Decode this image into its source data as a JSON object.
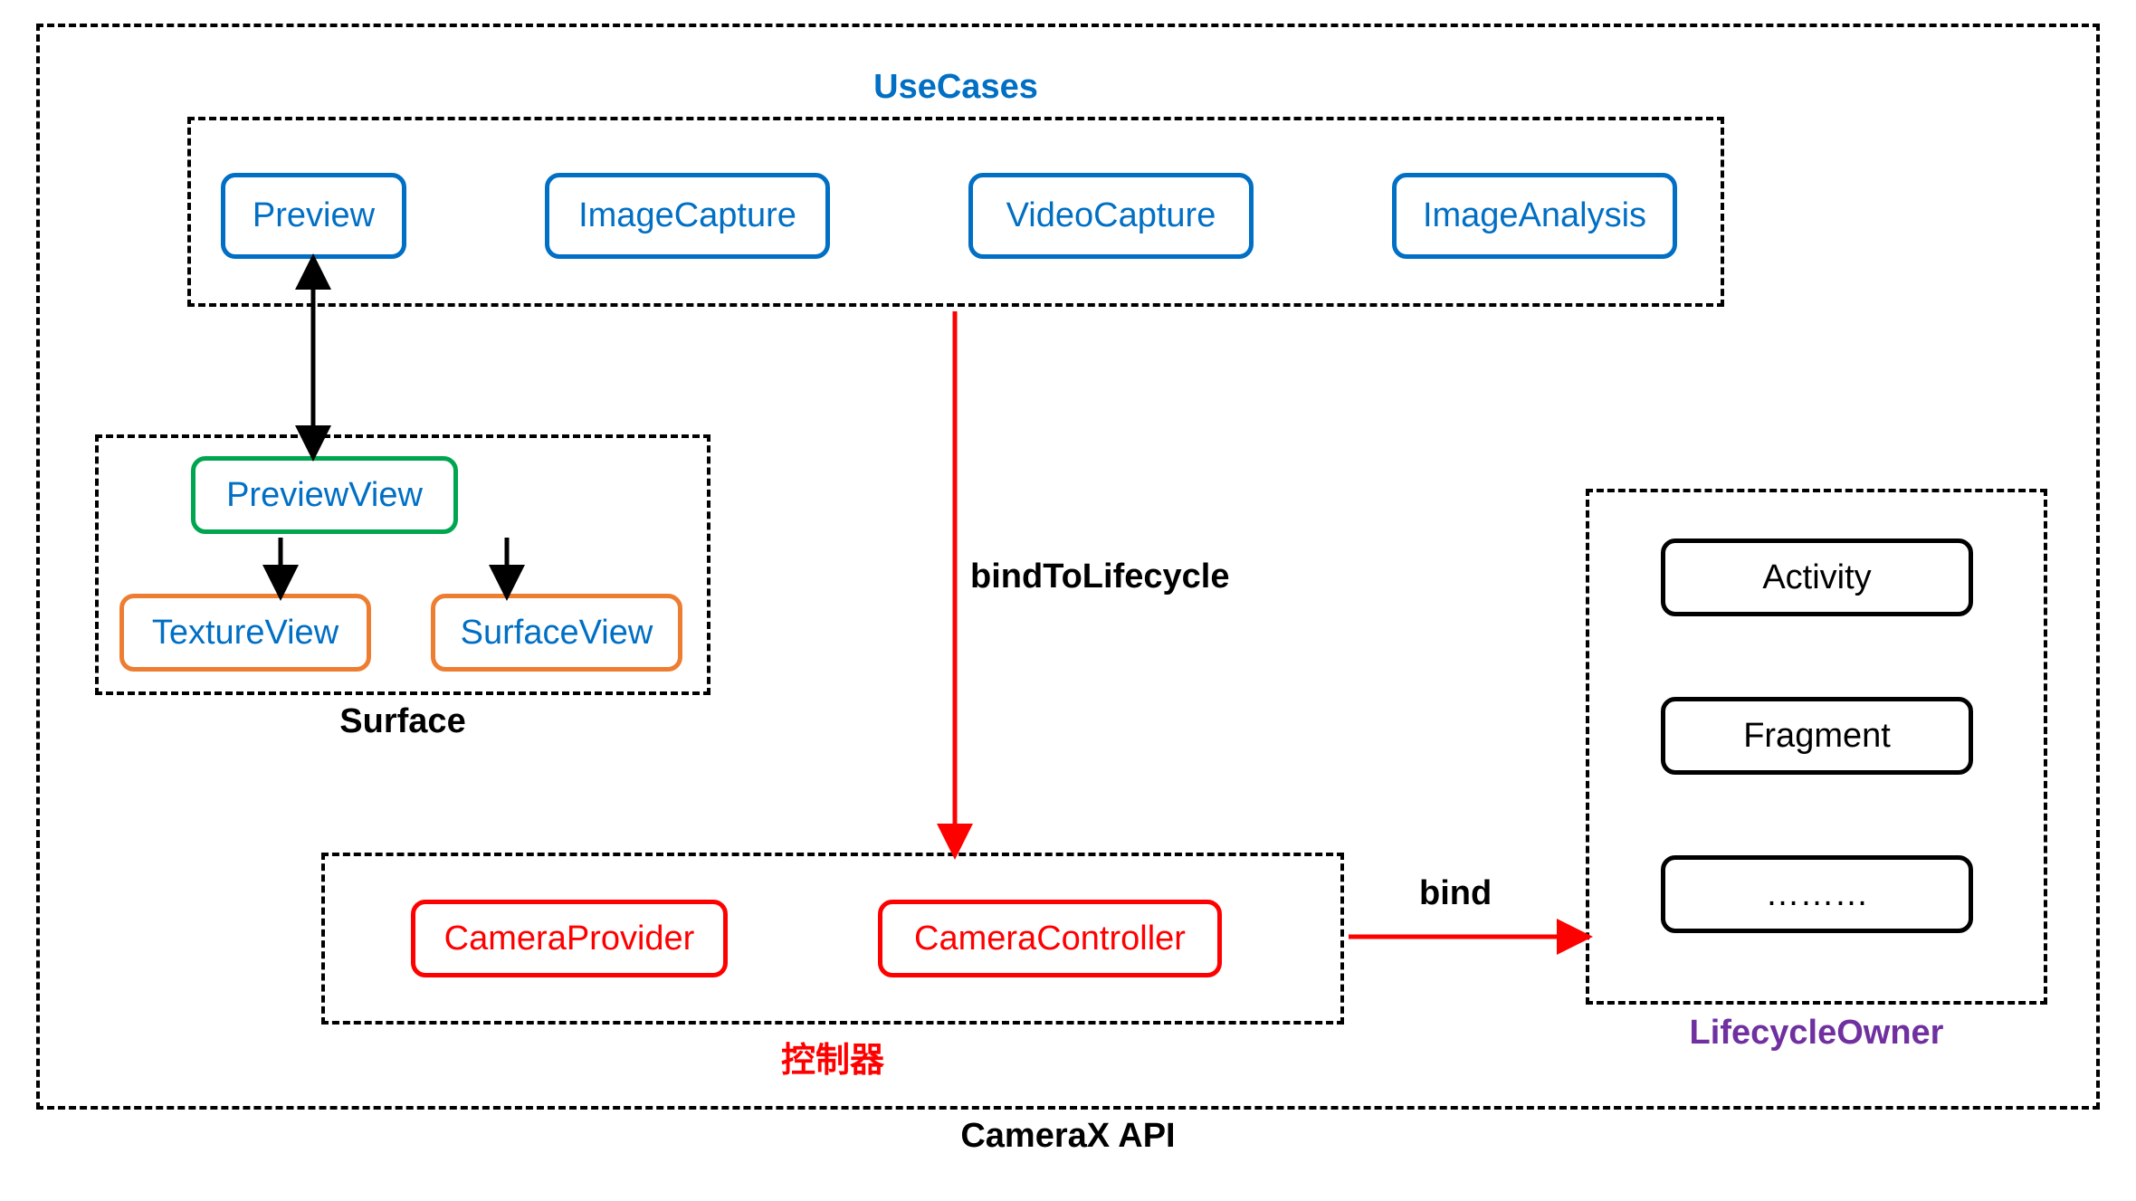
{
  "outer": {
    "label": "CameraX API"
  },
  "usecases": {
    "label": "UseCases",
    "items": [
      "Preview",
      "ImageCapture",
      "VideoCapture",
      "ImageAnalysis"
    ]
  },
  "surface": {
    "label": "Surface",
    "previewView": "PreviewView",
    "textureView": "TextureView",
    "surfaceView": "SurfaceView"
  },
  "controller": {
    "label": "控制器",
    "bindToLifecycle": "bindToLifecycle",
    "cameraProvider": "CameraProvider",
    "cameraController": "CameraController",
    "bind": "bind"
  },
  "lifecycle": {
    "label": "LifecycleOwner",
    "activity": "Activity",
    "fragment": "Fragment",
    "more": "………"
  }
}
